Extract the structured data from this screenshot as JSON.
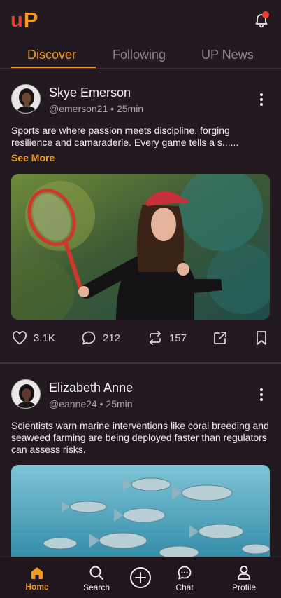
{
  "app": {
    "logo_text_u": "u",
    "logo_text_p": "P",
    "notification_icon": "bell-icon",
    "colors": {
      "accent": "#f39a1e",
      "brand_red": "#e8432e",
      "background": "#221a20"
    }
  },
  "tabs": [
    {
      "label": "Discover",
      "active": true
    },
    {
      "label": "Following",
      "active": false
    },
    {
      "label": "UP News",
      "active": false
    }
  ],
  "posts": [
    {
      "author": "Skye Emerson",
      "handle": "@emerson21",
      "time": "25min",
      "text": "Sports are where passion meets discipline, forging resilience and camaraderie. Every game tells a s......",
      "see_more": "See More",
      "image": "tennis-player-photo",
      "likes": "3.1K",
      "comments": "212",
      "reposts": "157"
    },
    {
      "author": "Elizabeth Anne",
      "handle": "@eanne24",
      "time": "25min",
      "text": "Scientists warn marine interventions like coral breeding and seaweed farming are being deployed faster than regulators can assess risks.",
      "image": "fish-school-photo"
    }
  ],
  "nav": [
    {
      "label": "Home",
      "icon": "home-icon",
      "active": true
    },
    {
      "label": "Search",
      "icon": "search-icon",
      "active": false
    },
    {
      "label": "",
      "icon": "add-circle-icon",
      "active": false
    },
    {
      "label": "Chat",
      "icon": "chat-icon",
      "active": false
    },
    {
      "label": "Profile",
      "icon": "profile-icon",
      "active": false
    }
  ]
}
